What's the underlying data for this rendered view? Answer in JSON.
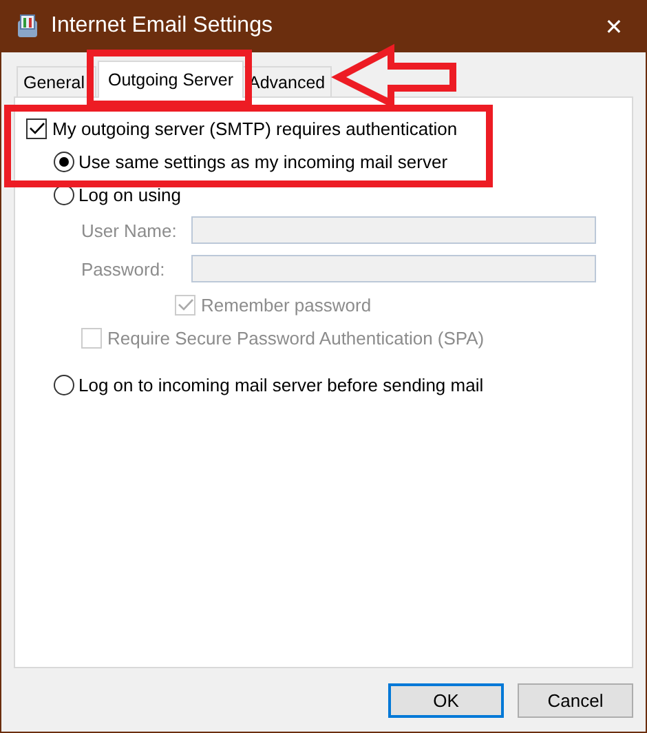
{
  "window": {
    "title": "Internet Email Settings",
    "close": "✕"
  },
  "tabs": [
    {
      "label": "General",
      "selected": false
    },
    {
      "label": "Outgoing Server",
      "selected": true
    },
    {
      "label": "Advanced",
      "selected": false
    }
  ],
  "options": [
    {
      "kind": "checkbox",
      "label": "My outgoing server (SMTP) requires authentication",
      "checked": true,
      "children": [
        {
          "kind": "radio",
          "label": "Use same settings as my incoming mail server",
          "selected": true
        },
        {
          "kind": "radio",
          "label": "Log on using",
          "selected": false,
          "children": [
            {
              "kind": "field",
              "label": "User Name:",
              "disabled": true
            },
            {
              "kind": "field",
              "label": "Password:",
              "disabled": true
            },
            {
              "kind": "field-checkbox",
              "label": "Remember password",
              "checked": true,
              "disabled": true
            },
            {
              "kind": "checkbox",
              "label": "Require Secure Password Authentication (SPA)",
              "checked": false,
              "disabled": true
            }
          ]
        },
        {
          "kind": "radio",
          "label": "Log on to incoming mail server before sending mail",
          "selected": false
        }
      ]
    }
  ],
  "buttons": [
    {
      "label": "OK",
      "default": true
    },
    {
      "label": "Cancel",
      "default": false
    }
  ]
}
